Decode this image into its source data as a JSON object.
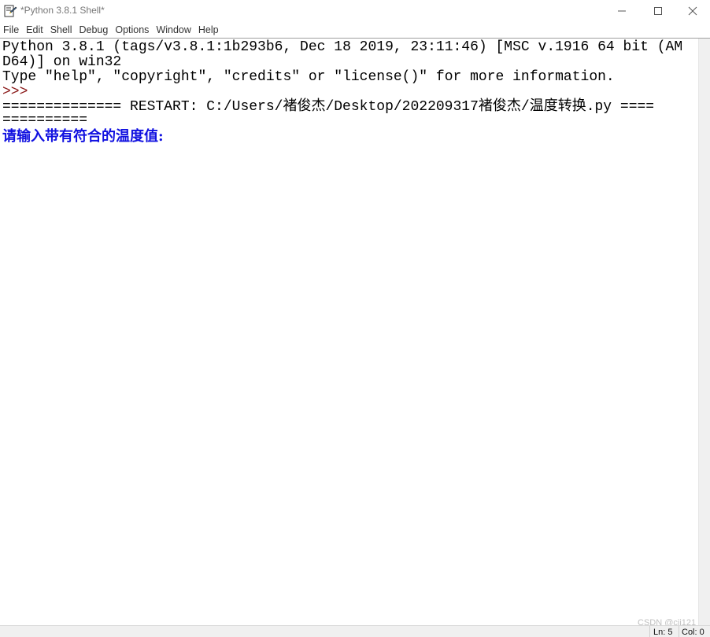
{
  "window": {
    "title": "*Python 3.8.1 Shell*",
    "icons": {
      "app": "python-idle-icon",
      "minimize": "minimize-icon",
      "maximize": "maximize-icon",
      "close": "close-icon"
    }
  },
  "menu": {
    "items": [
      "File",
      "Edit",
      "Shell",
      "Debug",
      "Options",
      "Window",
      "Help"
    ]
  },
  "shell": {
    "banner_line1": "Python 3.8.1 (tags/v3.8.1:1b293b6, Dec 18 2019, 23:11:46) [MSC v.1916 64 bit (AM",
    "banner_line2": "D64)] on win32",
    "banner_line3": "Type \"help\", \"copyright\", \"credits\" or \"license()\" for more information.",
    "prompt": ">>>",
    "restart_line1": "============== RESTART: C:/Users/褚俊杰/Desktop/202209317褚俊杰/温度转换.py ====",
    "restart_line2": "==========",
    "input_prompt": "请输入带有符合的温度值:"
  },
  "colors": {
    "prompt": "#8b1a1a",
    "stdout": "#1010e0",
    "text": "#000000"
  },
  "status": {
    "ln": "Ln: 5",
    "col": "Col: 0"
  },
  "watermark": "CSDN @cjj121"
}
